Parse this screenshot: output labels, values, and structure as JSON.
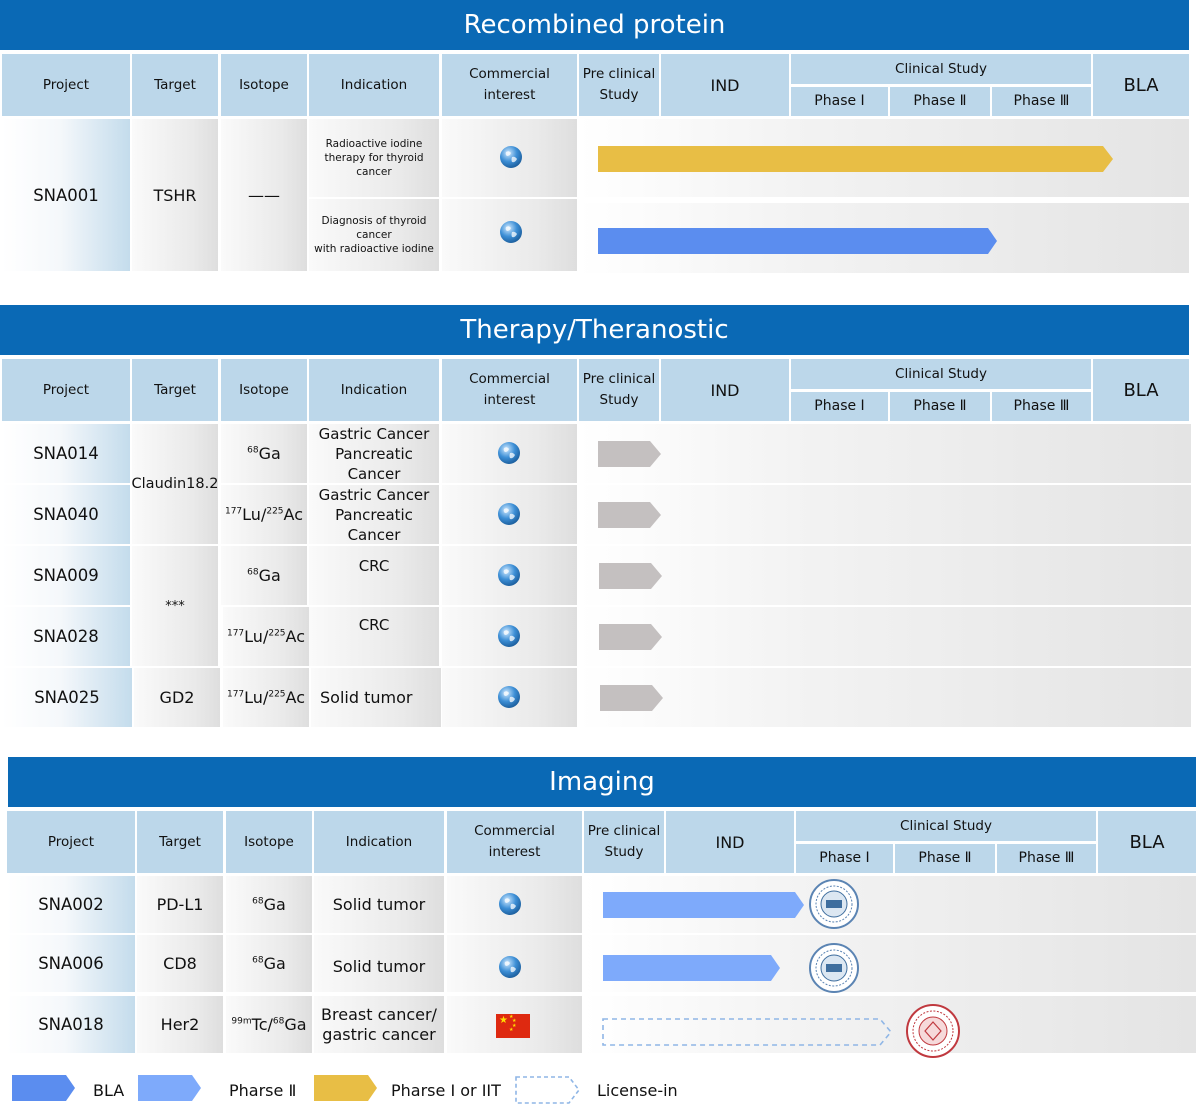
{
  "sections": {
    "recombined": "Recombined protein",
    "therapy": "Therapy/Theranostic",
    "imaging": "Imaging"
  },
  "headers": {
    "project": "Project",
    "target": "Target",
    "isotope": "Isotope",
    "indication": "Indication",
    "commercial_line1": "Commercial",
    "commercial_line2": "interest",
    "preclinical_line1": "Pre clinical",
    "preclinical_line2": "Study",
    "ind": "IND",
    "clinical": "Clinical Study",
    "phase1": "Phase Ⅰ",
    "phase2": "Phase Ⅱ",
    "phase3": "Phase Ⅲ",
    "bla": "BLA"
  },
  "recombined_rows": {
    "project": "SNA001",
    "target": "TSHR",
    "isotope": "——",
    "indication1_line1": "Radioactive iodine",
    "indication1_line2": "therapy for thyroid cancer",
    "indication2_line1": "Diagnosis of thyroid cancer",
    "indication2_line2": "with radioactive iodine"
  },
  "therapy_rows": {
    "sna014": "SNA014",
    "sna040": "SNA040",
    "sna009": "SNA009",
    "sna028": "SNA028",
    "sna025": "SNA025",
    "target_claudin": "Claudin18.2",
    "target_stars": "***",
    "target_gd2": "GD2",
    "iso_ga_mass": "68",
    "iso_ga": "Ga",
    "iso_lu_mass": "177",
    "iso_lu": "Lu/",
    "iso_ac_mass": "225",
    "iso_ac": "Ac",
    "ind_gastric": "Gastric Cancer",
    "ind_pancreatic": "Pancreatic Cancer",
    "ind_crc": "CRC",
    "ind_solid": "Solid tumor"
  },
  "imaging_rows": {
    "sna002": "SNA002",
    "sna006": "SNA006",
    "sna018": "SNA018",
    "target_pdl1": "PD-L1",
    "target_cd8": "CD8",
    "target_her2": "Her2",
    "iso_ga_mass": "68",
    "iso_ga": "Ga",
    "iso_tc_mass": "99m",
    "iso_tc": "Tc/",
    "ind_solid": "Solid tumor",
    "ind_breast_line1": "Breast cancer/",
    "ind_breast_line2": "gastric cancer"
  },
  "legend": {
    "bla": "BLA",
    "phase2": "Pharse Ⅱ",
    "phase1": "Pharse Ⅰ or IIT",
    "license": "License-in"
  },
  "colors": {
    "banner": "#0a69b5",
    "header": "#bcd7ea",
    "bla_arrow": "#5b8def",
    "phase2_arrow": "#7eaafb",
    "phase1_arrow": "#e8be45",
    "preclinical_arrow": "#c4c0c0",
    "license_outline": "#8fb6e6"
  },
  "chart_data": {
    "type": "table",
    "stage_columns": [
      "Pre clinical Study",
      "IND",
      "Phase Ⅰ",
      "Phase Ⅱ",
      "Phase Ⅲ",
      "BLA"
    ],
    "programs": [
      {
        "section": "Recombined protein",
        "project": "SNA001",
        "target": "TSHR",
        "indication": "Radioactive iodine therapy for thyroid cancer",
        "commercial_interest": "global",
        "status": "Pharse Ⅰ or IIT",
        "bar_end_stage": "Phase Ⅲ"
      },
      {
        "section": "Recombined protein",
        "project": "SNA001",
        "target": "TSHR",
        "indication": "Diagnosis of thyroid cancer with radioactive iodine",
        "commercial_interest": "global",
        "status": "BLA",
        "bar_end_stage": "Phase Ⅲ"
      },
      {
        "section": "Therapy/Theranostic",
        "project": "SNA014",
        "target": "Claudin18.2",
        "isotope": "68Ga",
        "indication": "Gastric Cancer Pancreatic Cancer",
        "commercial_interest": "global",
        "status": "preclinical",
        "bar_end_stage": "Pre clinical Study"
      },
      {
        "section": "Therapy/Theranostic",
        "project": "SNA040",
        "target": "Claudin18.2",
        "isotope": "177Lu/225Ac",
        "indication": "Gastric Cancer Pancreatic Cancer",
        "commercial_interest": "global",
        "status": "preclinical",
        "bar_end_stage": "Pre clinical Study"
      },
      {
        "section": "Therapy/Theranostic",
        "project": "SNA009",
        "target": "***",
        "isotope": "68Ga",
        "indication": "CRC",
        "commercial_interest": "global",
        "status": "preclinical",
        "bar_end_stage": "Pre clinical Study"
      },
      {
        "section": "Therapy/Theranostic",
        "project": "SNA028",
        "target": "***",
        "isotope": "177Lu/225Ac",
        "indication": "CRC",
        "commercial_interest": "global",
        "status": "preclinical",
        "bar_end_stage": "Pre clinical Study"
      },
      {
        "section": "Therapy/Theranostic",
        "project": "SNA025",
        "target": "GD2",
        "isotope": "177Lu/225Ac",
        "indication": "Solid tumor",
        "commercial_interest": "global",
        "status": "preclinical",
        "bar_end_stage": "Pre clinical Study"
      },
      {
        "section": "Imaging",
        "project": "SNA002",
        "target": "PD-L1",
        "isotope": "68Ga",
        "indication": "Solid tumor",
        "commercial_interest": "global",
        "status": "Pharse Ⅱ",
        "bar_end_stage": "IND",
        "partner_seal": "blue"
      },
      {
        "section": "Imaging",
        "project": "SNA006",
        "target": "CD8",
        "isotope": "68Ga",
        "indication": "Solid tumor",
        "commercial_interest": "global",
        "status": "Pharse Ⅱ",
        "bar_end_stage": "IND",
        "partner_seal": "blue"
      },
      {
        "section": "Imaging",
        "project": "SNA018",
        "target": "Her2",
        "isotope": "99mTc/68Ga",
        "indication": "Breast cancer/gastric cancer",
        "commercial_interest": "china",
        "status": "License-in",
        "bar_end_stage": "Phase Ⅰ",
        "partner_seal": "red"
      }
    ]
  }
}
